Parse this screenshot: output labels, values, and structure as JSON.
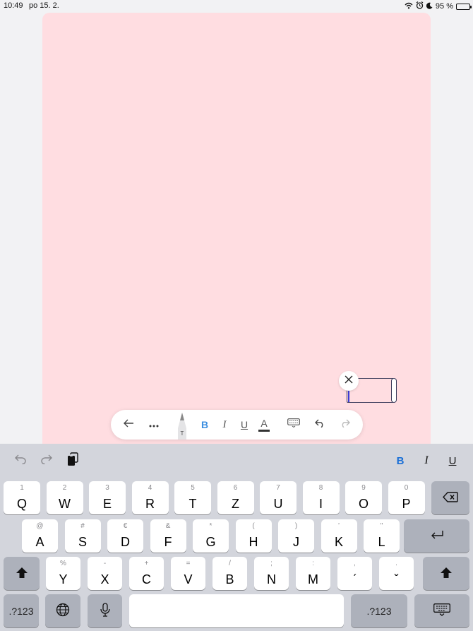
{
  "status_bar": {
    "time": "10:49",
    "date": "po 15. 2.",
    "battery": "95 %",
    "battery_level": 0.95
  },
  "canvas": {
    "background": "#ffdde1"
  },
  "text_box": {
    "value": ""
  },
  "toolbar": {
    "bold": "B",
    "italic": "I",
    "underline": "U",
    "text_color": "A",
    "pen_label": "T"
  },
  "keyboard_bar": {
    "bold": "B",
    "italic": "I",
    "underline": "U"
  },
  "keyboard": {
    "row1": [
      {
        "sub": "1",
        "main": "Q"
      },
      {
        "sub": "2",
        "main": "W"
      },
      {
        "sub": "3",
        "main": "E"
      },
      {
        "sub": "4",
        "main": "R"
      },
      {
        "sub": "5",
        "main": "T"
      },
      {
        "sub": "6",
        "main": "Z"
      },
      {
        "sub": "7",
        "main": "U"
      },
      {
        "sub": "8",
        "main": "I"
      },
      {
        "sub": "9",
        "main": "O"
      },
      {
        "sub": "0",
        "main": "P"
      }
    ],
    "row2": [
      {
        "sub": "@",
        "main": "A"
      },
      {
        "sub": "#",
        "main": "S"
      },
      {
        "sub": "€",
        "main": "D"
      },
      {
        "sub": "&",
        "main": "F"
      },
      {
        "sub": "*",
        "main": "G"
      },
      {
        "sub": "(",
        "main": "H"
      },
      {
        "sub": ")",
        "main": "J"
      },
      {
        "sub": "’",
        "main": "K"
      },
      {
        "sub": "\"",
        "main": "L"
      }
    ],
    "row3": [
      {
        "sub": "%",
        "main": "Y"
      },
      {
        "sub": "-",
        "main": "X"
      },
      {
        "sub": "+",
        "main": "C"
      },
      {
        "sub": "=",
        "main": "V"
      },
      {
        "sub": "/",
        "main": "B"
      },
      {
        "sub": ";",
        "main": "N"
      },
      {
        "sub": ":",
        "main": "M"
      },
      {
        "sub": ",",
        "main": "ˊ"
      },
      {
        "sub": ".",
        "main": "ˇ"
      }
    ],
    "numbers_left": ".?123",
    "numbers_right": ".?123"
  }
}
